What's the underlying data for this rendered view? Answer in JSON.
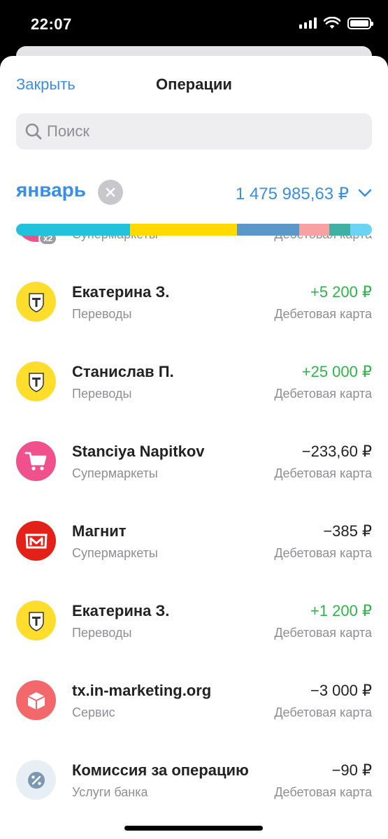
{
  "status_bar": {
    "time": "22:07",
    "icons": [
      "signal-icon",
      "wifi-icon",
      "battery-icon"
    ]
  },
  "header": {
    "close_label": "Закрыть",
    "title": "Операции"
  },
  "search": {
    "placeholder": "Поиск",
    "value": ""
  },
  "period": {
    "month_label": "январь",
    "total": "1 475 985,63 ₽",
    "breakdown": [
      {
        "color": "#22c1dc",
        "share": 0.32
      },
      {
        "color": "#ffd900",
        "share": 0.3
      },
      {
        "color": "#5b97c9",
        "share": 0.175
      },
      {
        "color": "#f7a1a2",
        "share": 0.085
      },
      {
        "color": "#3fb0a3",
        "share": 0.06
      },
      {
        "color": "#6dd3f2",
        "share": 0.06
      }
    ]
  },
  "colors": {
    "accent": "#3a8ee6",
    "income": "#2eb44a",
    "tinkoff_yellow": "#ffdd2d",
    "supermarket_pink": "#f0508c",
    "magnit_red": "#e32119",
    "service_salmon": "#f3686a",
    "bank_fee_gray": "#e7eef4"
  },
  "operations": [
    {
      "title": "",
      "category": "Супермаркеты",
      "amount": "",
      "account": "Дебетовая карта",
      "avatar": "cart-icon",
      "avatar_bg": "#f0508c",
      "badge": "x2",
      "income": false
    },
    {
      "title": "Екатерина З.",
      "category": "Переводы",
      "amount": "+5 200 ₽",
      "account": "Дебетовая карта",
      "avatar": "tinkoff-logo-icon",
      "avatar_bg": "#ffdd2d",
      "income": true
    },
    {
      "title": "Станислав П.",
      "category": "Переводы",
      "amount": "+25 000 ₽",
      "account": "Дебетовая карта",
      "avatar": "tinkoff-logo-icon",
      "avatar_bg": "#ffdd2d",
      "income": true
    },
    {
      "title": "Stanciya Napitkov",
      "category": "Супермаркеты",
      "amount": "−233,60 ₽",
      "account": "Дебетовая карта",
      "avatar": "cart-icon",
      "avatar_bg": "#f0508c",
      "income": false
    },
    {
      "title": "Магнит",
      "category": "Супермаркеты",
      "amount": "−385 ₽",
      "account": "Дебетовая карта",
      "avatar": "magnit-logo-icon",
      "avatar_bg": "#e32119",
      "income": false
    },
    {
      "title": "Екатерина З.",
      "category": "Переводы",
      "amount": "+1 200 ₽",
      "account": "Дебетовая карта",
      "avatar": "tinkoff-logo-icon",
      "avatar_bg": "#ffdd2d",
      "income": true
    },
    {
      "title": "tx.in-marketing.org",
      "category": "Сервис",
      "amount": "−3 000 ₽",
      "account": "Дебетовая карта",
      "avatar": "box-icon",
      "avatar_bg": "#f3686a",
      "income": false
    },
    {
      "title": "Комиссия за операцию",
      "category": "Услуги банка",
      "amount": "−90 ₽",
      "account": "Дебетовая карта",
      "avatar": "percent-icon",
      "avatar_bg": "#e7eef4",
      "income": false
    }
  ]
}
